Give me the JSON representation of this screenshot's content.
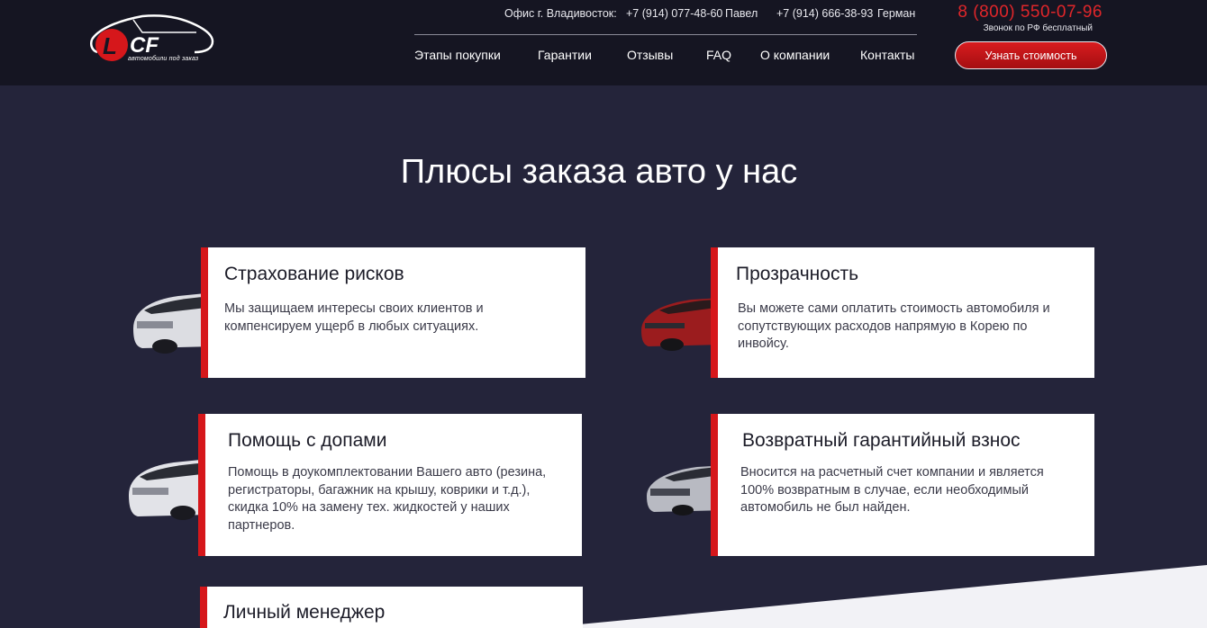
{
  "header": {
    "logo_tagline": "автомобили под заказ",
    "office_label": "Офис г. Владивосток:",
    "contact_1_phone": "+7 (914) 077-48-60",
    "contact_1_name": "Павел",
    "contact_2_phone": "+7 (914) 666-38-93",
    "contact_2_name": "Герман",
    "main_phone": "8 (800) 550-07-96",
    "main_phone_note": "Звонок по РФ бесплатный",
    "cta_label": "Узнать стоимость"
  },
  "nav": {
    "items": [
      {
        "label": "Этапы покупки"
      },
      {
        "label": "Гарантии"
      },
      {
        "label": "Отзывы"
      },
      {
        "label": "FAQ"
      },
      {
        "label": "О компании"
      },
      {
        "label": "Контакты"
      }
    ]
  },
  "section": {
    "title": "Плюсы заказа авто у нас"
  },
  "cards": [
    {
      "title": "Страхование рисков",
      "text": "Мы защищаем интересы своих клиентов и компенсируем ущерб в любых ситуациях."
    },
    {
      "title": "Прозрачность",
      "text": "Вы можете сами оплатить стоимость автомобиля и сопутствующих расходов напрямую в Корею по инвойсу."
    },
    {
      "title": "Помощь с допами",
      "text": "Помощь в доукомплектовании Вашего авто (резина, регистраторы, багажник на крышу, коврики и т.д.), скидка 10% на замену тех. жидкостей у наших партнеров."
    },
    {
      "title": "Возвратный гарантийный взнос",
      "text": "Вносится на расчетный счет компании и является 100% возвратным в случае, если необходимый автомобиль не был найден."
    },
    {
      "title": "Личный менеджер",
      "text": ""
    }
  ],
  "colors": {
    "accent": "#d6171b",
    "header_bg": "#151522",
    "page_bg": "#24243a"
  }
}
